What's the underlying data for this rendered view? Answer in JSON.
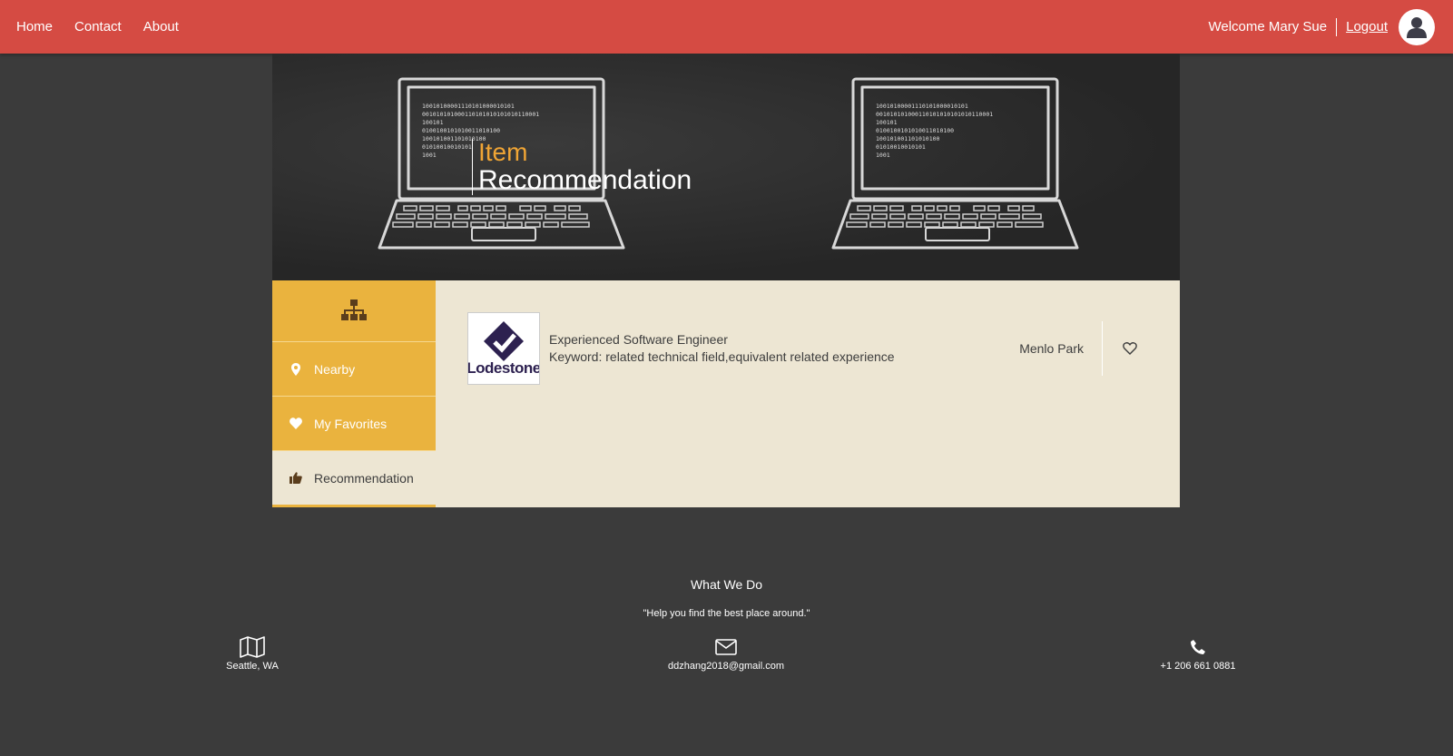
{
  "nav": {
    "links": [
      "Home",
      "Contact",
      "About"
    ],
    "welcome": "Welcome Mary Sue",
    "logout": "Logout",
    "avatar_icon": "user-icon"
  },
  "hero": {
    "title_line1": "Item",
    "title_line2": "Recommendation",
    "accent_color": "#f0a535",
    "laptop_code_lines": [
      "10010100001110101000010101",
      "001010101000110101010101010110001",
      "100101",
      "0100100101010011010100",
      "100101001101010100",
      "01010010010101",
      "1001"
    ]
  },
  "sidebar": {
    "header_icon": "sitemap-icon",
    "items": [
      {
        "label": "Nearby",
        "icon": "map-pin-icon"
      },
      {
        "label": "My Favorites",
        "icon": "heart-icon"
      },
      {
        "label": "Recommendation",
        "icon": "thumbs-up-icon"
      }
    ],
    "active": "Recommendation",
    "color": "#eab33e"
  },
  "results": {
    "items": [
      {
        "logo_text": "Lodestone",
        "name": "Experienced Software Engineer",
        "keyword": "Keyword: related technical field,equivalent related experience",
        "location": "Menlo Park",
        "favorite_icon": "heart-outline-icon"
      }
    ]
  },
  "footer": {
    "title": "What We Do",
    "quote": "\"Help you find the best place around.\"",
    "location": "Seattle, WA",
    "email": "ddzhang2018@gmail.com",
    "phone": "+1 206 661 0881"
  },
  "colors": {
    "topbar": "#d54b43",
    "background": "#3b3b3b",
    "panel": "#ede6d3"
  }
}
